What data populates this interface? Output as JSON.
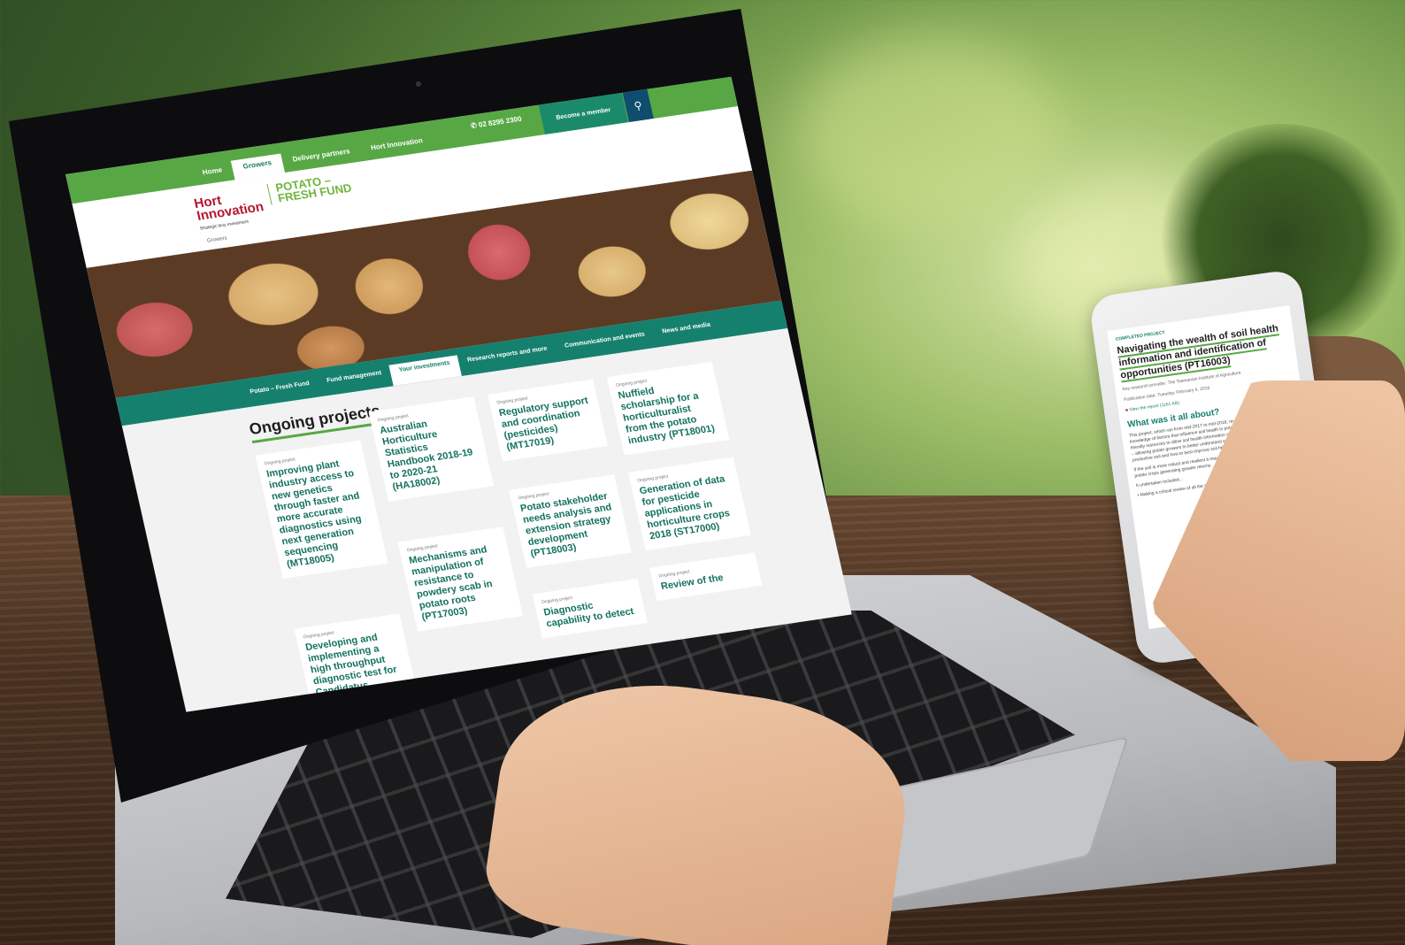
{
  "laptop": {
    "top_nav": [
      "Home",
      "Growers",
      "Delivery partners",
      "Hort Innovation"
    ],
    "phone": "02 8295 2300",
    "member_button": "Become a member",
    "logo": {
      "line1": "Hort",
      "line2": "Innovation",
      "tagline": "Strategic levy investment"
    },
    "fund_logo": {
      "line1": "POTATO –",
      "line2": "FRESH FUND"
    },
    "breadcrumb": "Growers",
    "sub_nav": [
      "Potato – Fresh Fund",
      "Fund management",
      "Your investments",
      "Research reports and more",
      "Communication and events",
      "News and media"
    ],
    "section_title": "Ongoing projects",
    "card_tag": "Ongoing project",
    "cards": [
      "Improving plant industry access to new genetics through faster and more accurate diagnostics using next generation sequencing (MT18005)",
      "Australian Horticulture Statistics Handbook 2018-19 to 2020-21 (HA18002)",
      "Regulatory support and coordination (pesticides) (MT17019)",
      "Nuffield scholarship for a horticulturalist from the potato industry (PT18001)",
      "Mechanisms and manipulation of resistance to powdery scab in potato roots (PT17003)",
      "Potato stakeholder needs analysis and extension strategy development (PT18003)",
      "Generation of data for pesticide applications in horticulture crops 2018 (ST17000)",
      "Developing and implementing a high throughput diagnostic test for Candidatus",
      "Diagnostic capability to detect",
      "Review of the"
    ]
  },
  "phone": {
    "tag": "COMPLETED PROJECT",
    "title": "Navigating the wealth of soil health information and identification of opportunities (PT16003)",
    "research_provider": "Key research provider: The Tasmanian Institute of Agriculture",
    "publication_date": "Publication date: Tuesday, February 6, 2018",
    "report_link": "View the report (1161 KB)",
    "heading": "What was it all about?",
    "para1": "This project, which ran from mid-2017 to mid-2018, reviewed the current state of knowledge of factors that influence soil health in potato growing. It produced grower-friendly resources to allow soil health information and R&D to be better utilised on-farm – allowing potato growers to better understand what constitutes a healthy and productive soil and how to best improve soil health.",
    "para2": "If the soil is more robust and resilient it may allow for shorter rotation times between potato crops generating greater returns.",
    "para3": "It undertaken included...",
    "bullet": "Making a critical review of all the scientific literature on soil health"
  },
  "colors": {
    "green": "#57a845",
    "teal": "#16806e",
    "navy": "#0e4d6e",
    "hort_red": "#b8152c"
  }
}
